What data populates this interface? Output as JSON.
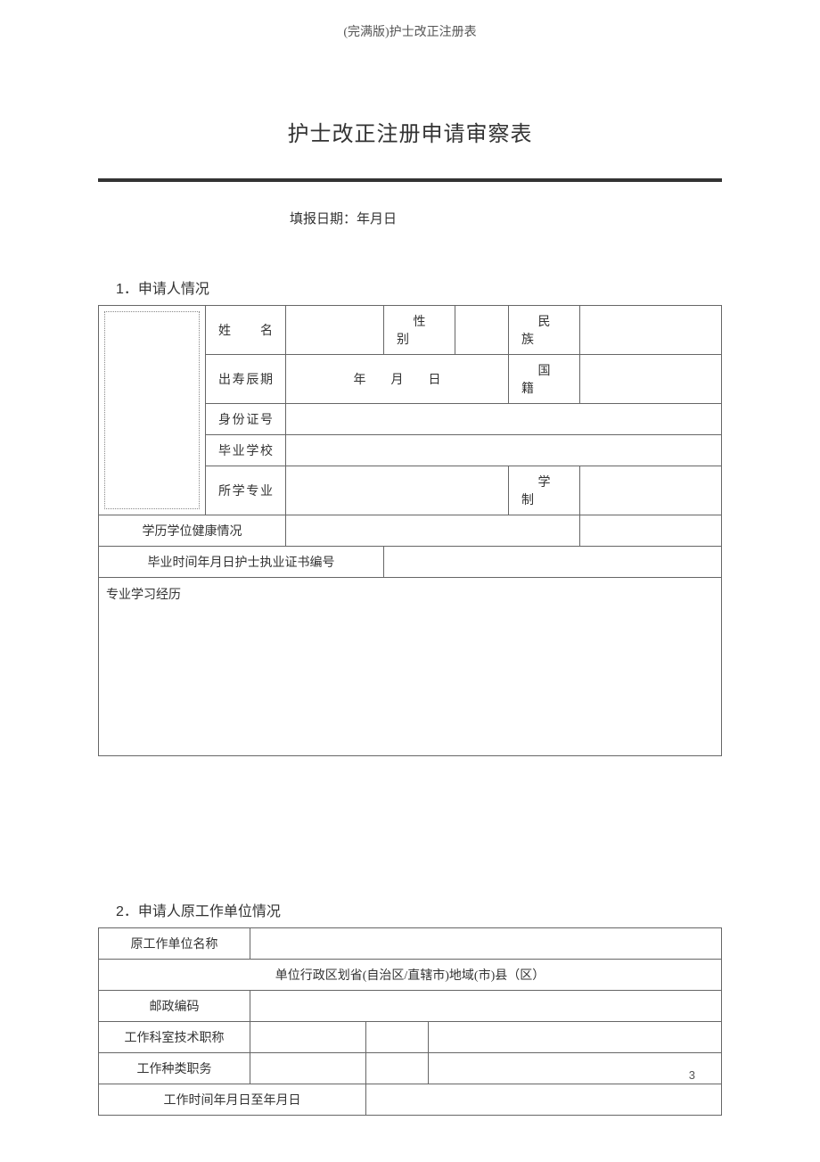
{
  "header_note": "(完满版)护士改正注册表",
  "main_title": "护士改正注册申请审察表",
  "fill_date_label": "填报日期：年月日",
  "section1": {
    "title_num": "1．",
    "title_text": "申请人情况",
    "labels": {
      "name": "姓　　名",
      "gender": "性　　别",
      "ethnic": "民　　族",
      "birth": "出寿辰期",
      "birth_val": "年　　月　　日",
      "nationality": "国　　籍",
      "id_no": "身份证号",
      "school": "毕业学校",
      "major": "所学专业",
      "edu_system": "学　　制",
      "degree_health": "学历学位健康情况",
      "grad_cert": "毕业时间年月日护士执业证书编号",
      "study_exp": "专业学习经历"
    }
  },
  "section2": {
    "title_num": "2．",
    "title_text": "申请人原工作单位情况",
    "labels": {
      "org_name": "原工作单位名称",
      "admin_div": "单位行政区划省(自治区/直辖市)地域(市)县（区）",
      "postcode": "邮政编码",
      "dept_title": "工作科室技术职称",
      "job_type": "工作种类职务",
      "work_time": "工作时间年月日至年月日"
    }
  },
  "page_number": "3"
}
